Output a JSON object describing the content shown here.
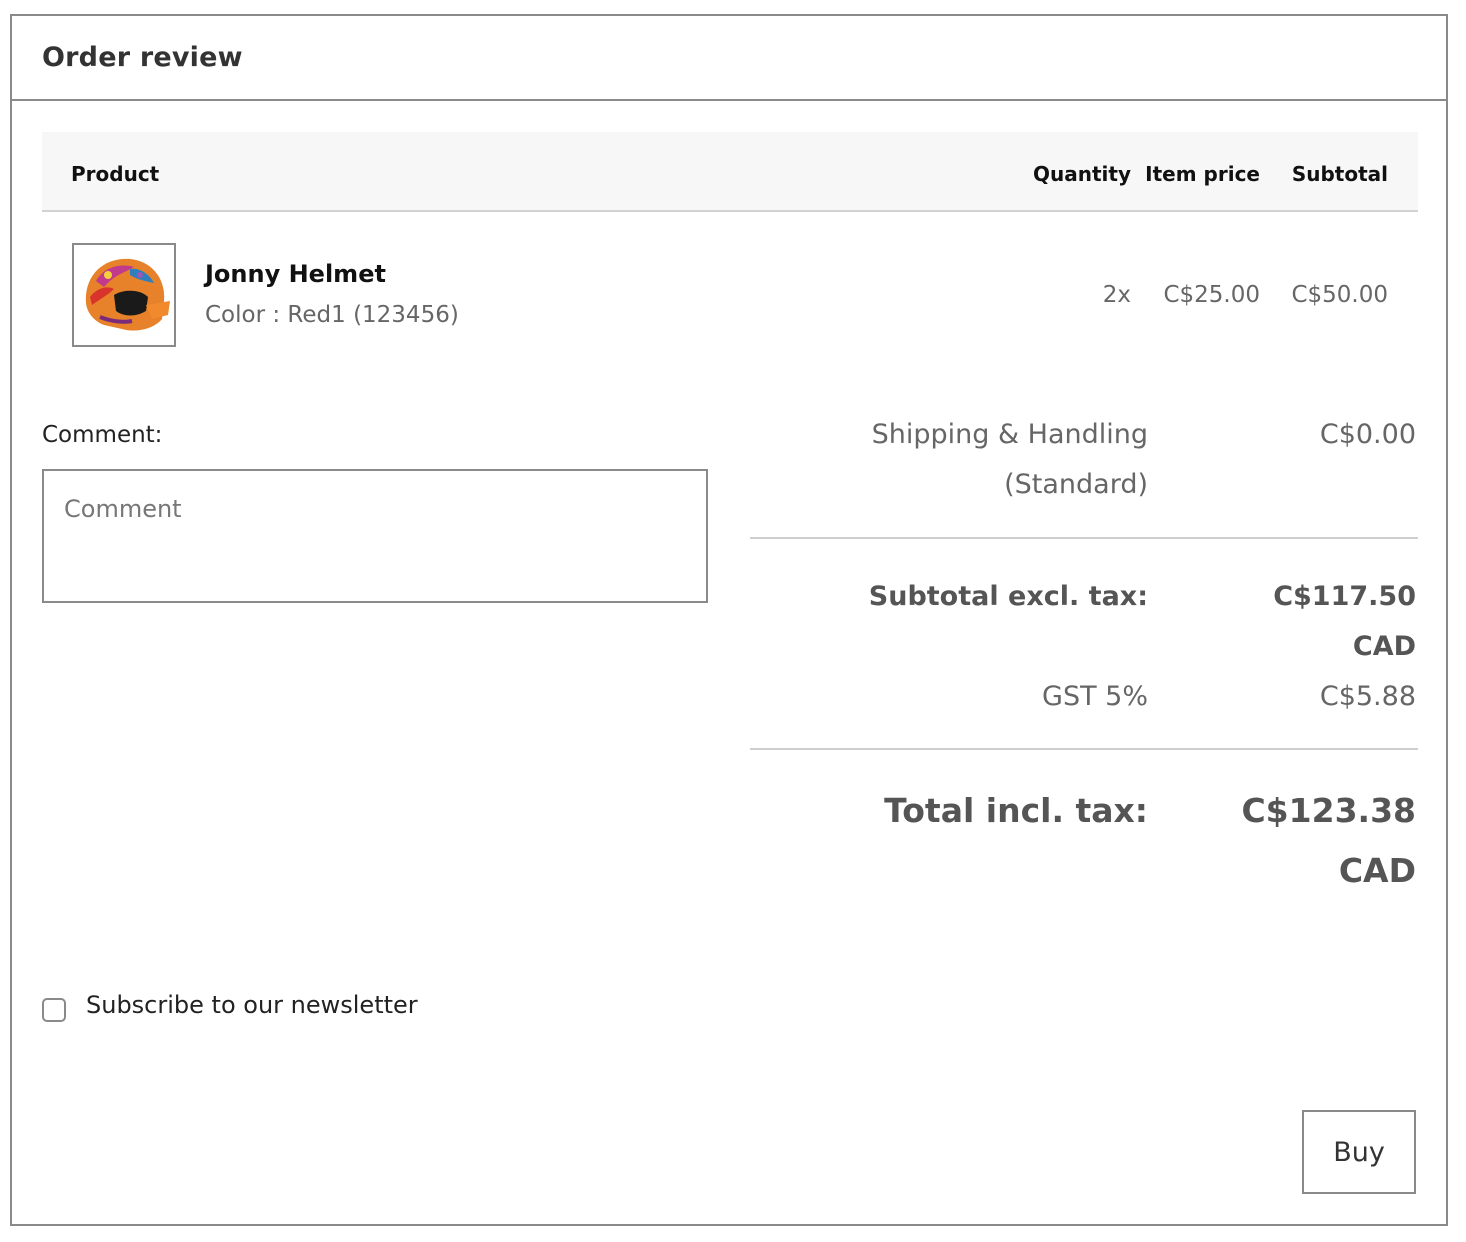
{
  "panel": {
    "title": "Order review"
  },
  "table": {
    "headers": {
      "product": "Product",
      "quantity": "Quantity",
      "item_price": "Item price",
      "subtotal": "Subtotal"
    },
    "rows": [
      {
        "name": "Jonny Helmet",
        "variant": "Color : Red1 (123456)",
        "quantity": "2x",
        "item_price": "C$25.00",
        "subtotal": "C$50.00",
        "image_icon": "helmet-image"
      }
    ]
  },
  "comment": {
    "label": "Comment:",
    "placeholder": "Comment",
    "value": ""
  },
  "totals": {
    "shipping_label_1": "Shipping & Handling",
    "shipping_label_2": "(Standard)",
    "shipping_value": "C$0.00",
    "subtotal_label": "Subtotal excl. tax:",
    "subtotal_value_1": "C$117.50",
    "subtotal_value_2": "CAD",
    "tax_label": "GST 5%",
    "tax_value": "C$5.88",
    "total_label": "Total incl. tax:",
    "total_value_1": "C$123.38",
    "total_value_2": "CAD"
  },
  "newsletter": {
    "label": "Subscribe to our newsletter",
    "checked": false
  },
  "actions": {
    "buy_label": "Buy"
  },
  "colors": {
    "border": "#8a8a8a",
    "header_bg": "#f7f7f7",
    "muted_text": "#666666",
    "total_text": "#555555"
  }
}
